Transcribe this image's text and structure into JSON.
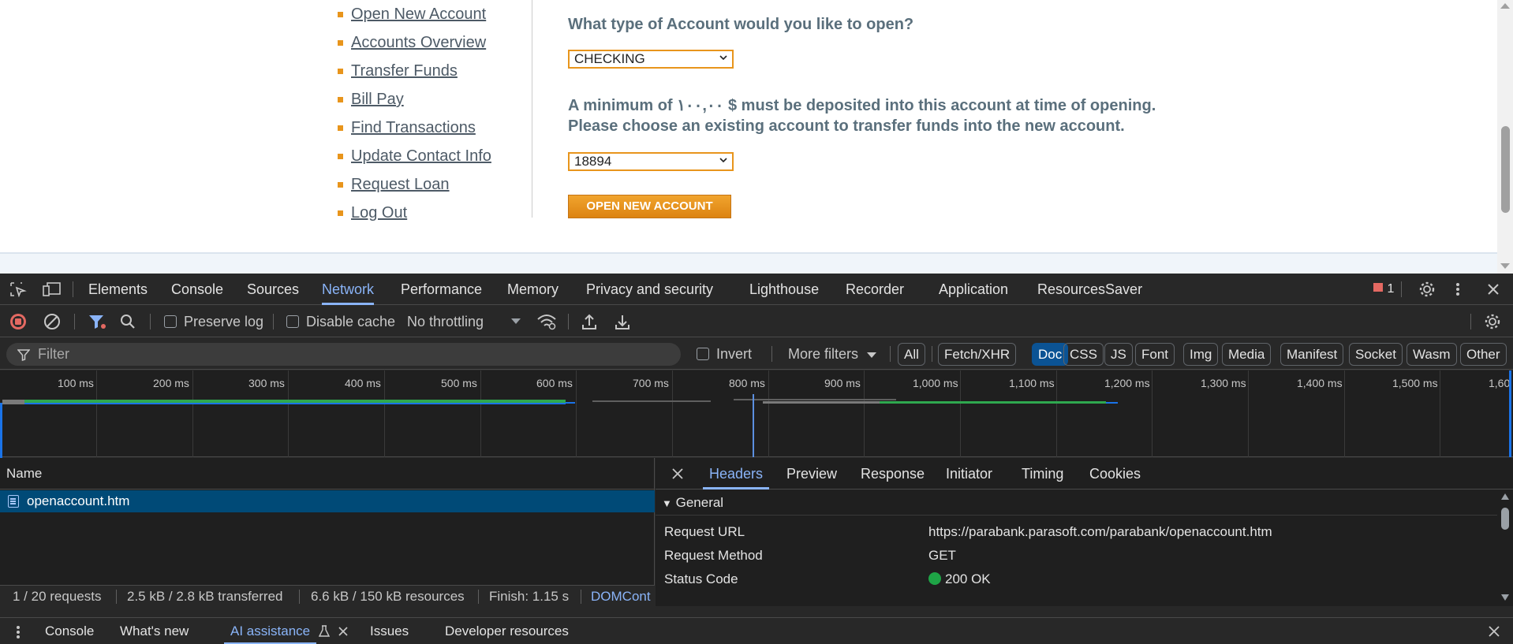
{
  "webpage": {
    "menu": [
      "Open New Account",
      "Accounts Overview",
      "Transfer Funds",
      "Bill Pay",
      "Find Transactions",
      "Update Contact Info",
      "Request Loan",
      "Log Out"
    ],
    "question": "What type of Account would you like to open?",
    "account_type": "CHECKING",
    "min_deposit_msg": "A minimum of ١٠٠,٠٠ $ must be deposited into this account at time of opening.",
    "choose_msg": "Please choose an existing account to transfer funds into the new account.",
    "from_account": "18894",
    "open_button": "OPEN NEW ACCOUNT",
    "accent_color": "#e8951c"
  },
  "devtools": {
    "tabs": [
      "Elements",
      "Console",
      "Sources",
      "Network",
      "Performance",
      "Memory",
      "Privacy and security",
      "Lighthouse",
      "Recorder",
      "Application",
      "ResourcesSaver"
    ],
    "active_tab": "Network",
    "issues_count": "1",
    "toolbar": {
      "preserve_log": "Preserve log",
      "disable_cache": "Disable cache",
      "throttling": "No throttling"
    },
    "filter": {
      "placeholder": "Filter",
      "invert": "Invert",
      "more_filters": "More filters",
      "chips": [
        "All",
        "Fetch/XHR",
        "Doc",
        "CSS",
        "JS",
        "Font",
        "Img",
        "Media",
        "Manifest",
        "Socket",
        "Wasm",
        "Other"
      ],
      "active_chip": "Doc"
    },
    "timeline_ticks": [
      "100 ms",
      "200 ms",
      "300 ms",
      "400 ms",
      "500 ms",
      "600 ms",
      "700 ms",
      "800 ms",
      "900 ms",
      "1,000 ms",
      "1,100 ms",
      "1,200 ms",
      "1,300 ms",
      "1,400 ms",
      "1,500 ms",
      "1,60"
    ],
    "requests": {
      "column": "Name",
      "items": [
        "openaccount.htm"
      ]
    },
    "status": {
      "requests": "1 / 20 requests",
      "transferred": "2.5 kB / 2.8 kB transferred",
      "resources": "6.6 kB / 150 kB resources",
      "finish": "Finish: 1.15 s",
      "domcontent": "DOMCont"
    },
    "detail": {
      "tabs": [
        "Headers",
        "Preview",
        "Response",
        "Initiator",
        "Timing",
        "Cookies"
      ],
      "active": "Headers",
      "section": "General",
      "rows": [
        {
          "key": "Request URL",
          "value": "https://parabank.parasoft.com/parabank/openaccount.htm"
        },
        {
          "key": "Request Method",
          "value": "GET"
        },
        {
          "key": "Status Code",
          "value": "200 OK"
        }
      ],
      "status_color": "#1ea446"
    },
    "drawer": {
      "tabs": [
        "Console",
        "What's new",
        "AI assistance",
        "Issues",
        "Developer resources"
      ],
      "active": "AI assistance"
    },
    "accent_color": "#8ab4f8"
  }
}
